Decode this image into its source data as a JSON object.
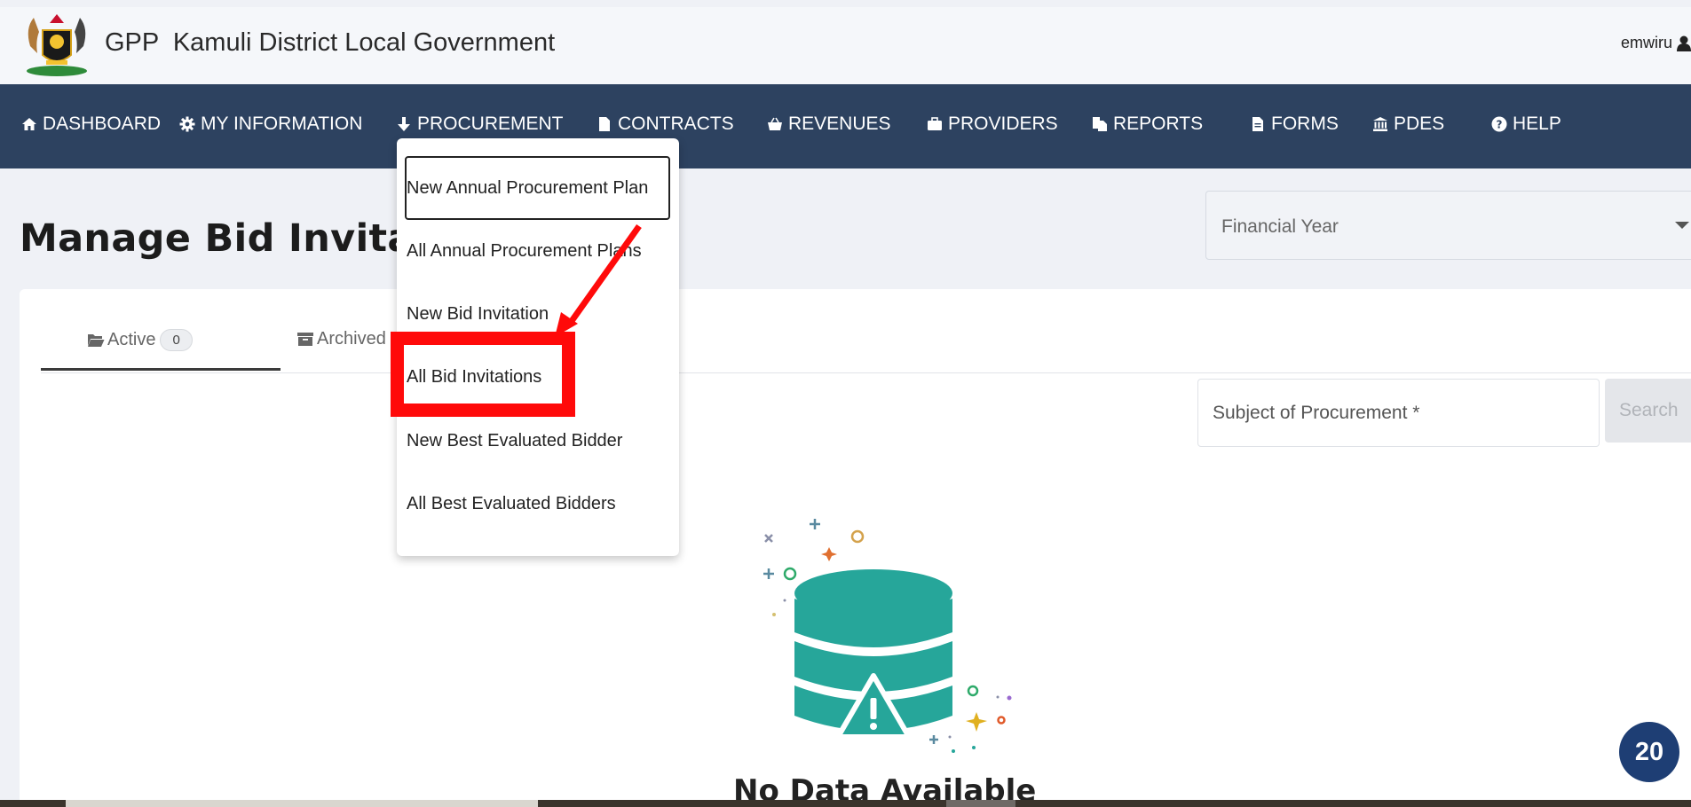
{
  "header": {
    "app_title": "GPP  Kamuli District Local Government",
    "username": "emwiru"
  },
  "nav": [
    {
      "label": "DASHBOARD",
      "icon": "home-icon"
    },
    {
      "label": "MY INFORMATION",
      "icon": "gear-icon"
    },
    {
      "label": "PROCUREMENT",
      "icon": "arrow-down-icon"
    },
    {
      "label": "CONTRACTS",
      "icon": "file-icon"
    },
    {
      "label": "REVENUES",
      "icon": "basket-icon"
    },
    {
      "label": "PROVIDERS",
      "icon": "briefcase-icon"
    },
    {
      "label": "REPORTS",
      "icon": "copy-file-icon"
    },
    {
      "label": "FORMS",
      "icon": "file-text-icon"
    },
    {
      "label": "PDES",
      "icon": "bank-icon"
    },
    {
      "label": "HELP",
      "icon": "question-icon"
    }
  ],
  "page": {
    "title": "Manage Bid Invitatio",
    "financial_year_placeholder": "Financial Year"
  },
  "tabs": [
    {
      "label": "Active",
      "count": "0",
      "icon": "folder-open-icon"
    },
    {
      "label": "Archived",
      "icon": "archive-icon"
    }
  ],
  "search": {
    "placeholder": "Subject of Procurement *",
    "button_label": "Search"
  },
  "empty_state": {
    "message": "No Data Available",
    "icon": "database-warning-icon",
    "accent_color": "#26a69a"
  },
  "procurement_menu": {
    "items": [
      "New Annual Procurement Plan",
      "All Annual Procurement Plans",
      "New Bid Invitation",
      "All Bid Invitations",
      "New Best Evaluated Bidder",
      "All Best Evaluated Bidders"
    ],
    "highlighted_item": "All Bid Invitations"
  },
  "annotation_color": "#ff0a0a",
  "counter_badge": "20"
}
